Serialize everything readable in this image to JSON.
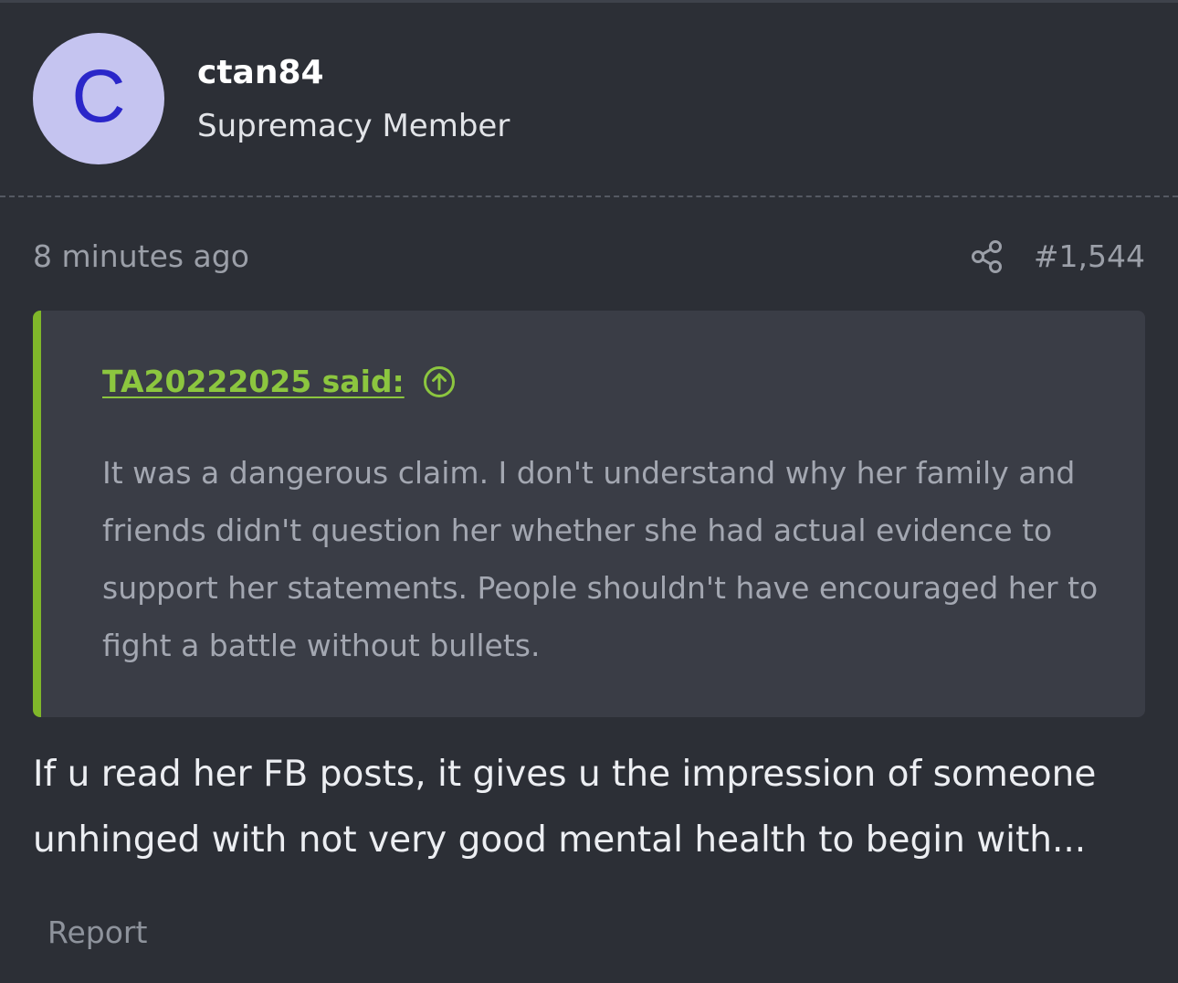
{
  "author": {
    "avatar_letter": "C",
    "username": "ctan84",
    "title": "Supremacy Member"
  },
  "meta": {
    "timestamp": "8 minutes ago",
    "post_number": "#1,544",
    "share_icon": "share-icon"
  },
  "quote": {
    "attribution": "TA20222025 said:",
    "jump_icon": "arrow-up-circle-icon",
    "body": "It was a dangerous claim. I don't understand why her family and friends didn't question her whether she had actual evidence to support her statements. People shouldn't have encouraged her to fight a battle without bullets."
  },
  "post": {
    "body": "If u read her FB posts, it gives u the impression of someone unhinged with not very good mental health to begin with..."
  },
  "actions": {
    "report_label": "Report"
  },
  "colors": {
    "background": "#2c2f36",
    "quote_background": "#3a3d46",
    "accent": "#8cc63f",
    "avatar_bg": "#c5c4f0",
    "avatar_letter": "#2a26c9"
  }
}
